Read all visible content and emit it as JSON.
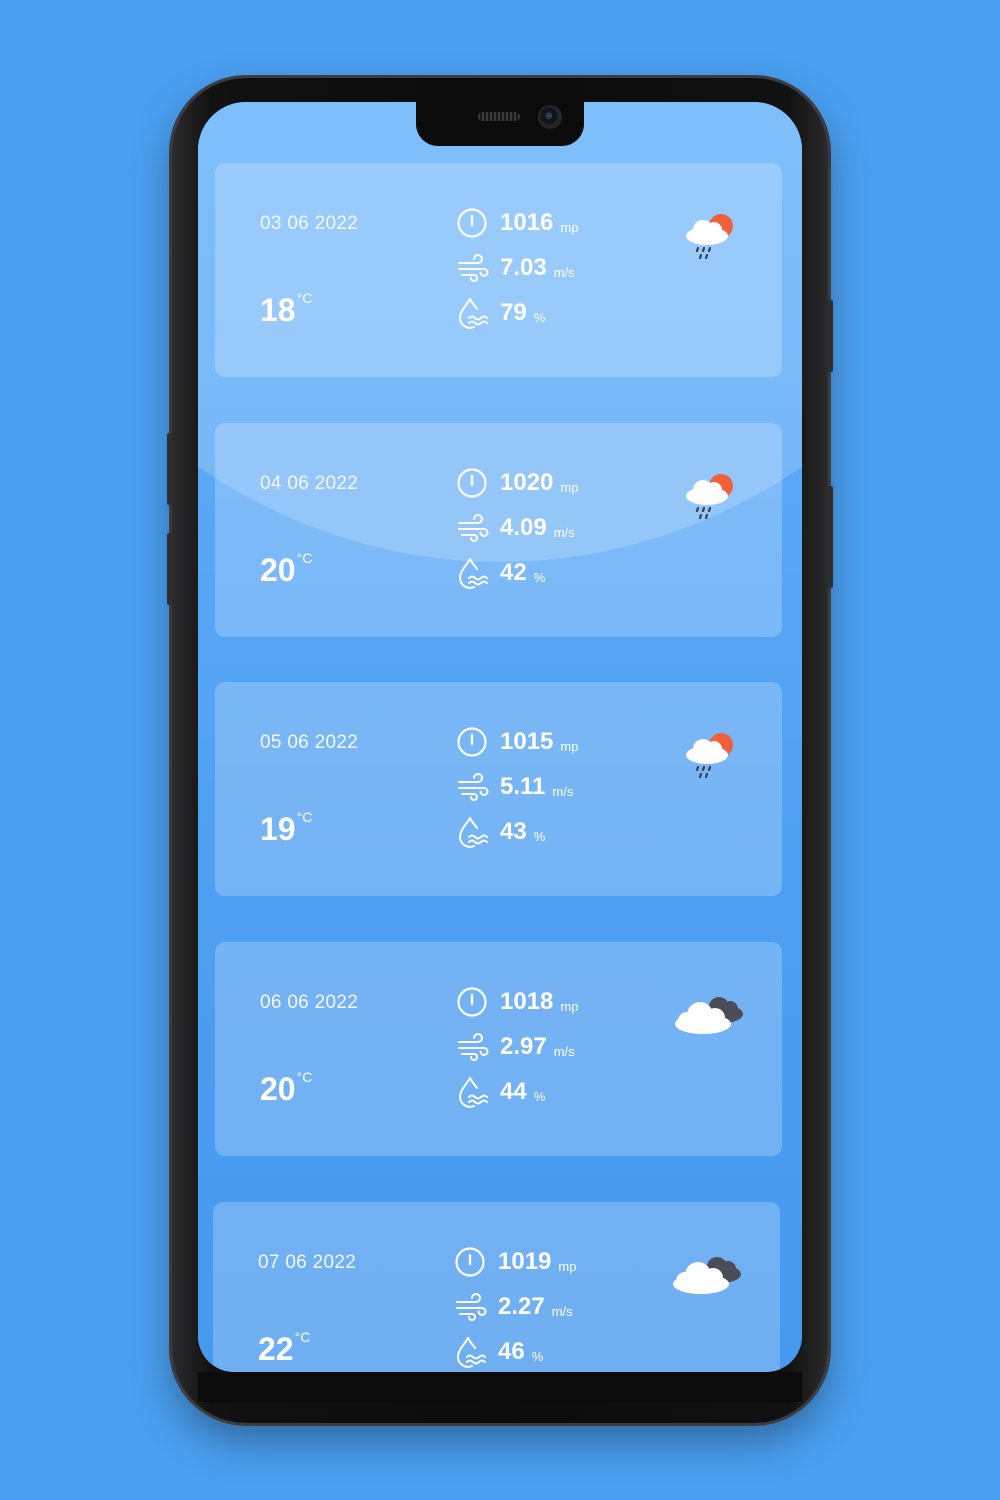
{
  "forecast": [
    {
      "date": "03 06 2022",
      "temp": "18",
      "temp_unit": "°C",
      "pressure": "1016",
      "pressure_unit": "mp",
      "wind": "7.03",
      "wind_unit": "m/s",
      "humidity": "79",
      "humidity_unit": "%",
      "icon": "cloud-sun-rain-icon"
    },
    {
      "date": "04 06 2022",
      "temp": "20",
      "temp_unit": "°C",
      "pressure": "1020",
      "pressure_unit": "mp",
      "wind": "4.09",
      "wind_unit": "m/s",
      "humidity": "42",
      "humidity_unit": "%",
      "icon": "cloud-sun-rain-icon"
    },
    {
      "date": "05 06 2022",
      "temp": "19",
      "temp_unit": "°C",
      "pressure": "1015",
      "pressure_unit": "mp",
      "wind": "5.11",
      "wind_unit": "m/s",
      "humidity": "43",
      "humidity_unit": "%",
      "icon": "cloud-sun-rain-icon"
    },
    {
      "date": "06 06 2022",
      "temp": "20",
      "temp_unit": "°C",
      "pressure": "1018",
      "pressure_unit": "mp",
      "wind": "2.97",
      "wind_unit": "m/s",
      "humidity": "44",
      "humidity_unit": "%",
      "icon": "broken-clouds-icon"
    },
    {
      "date": "07 06 2022",
      "temp": "22",
      "temp_unit": "°C",
      "pressure": "1019",
      "pressure_unit": "mp",
      "wind": "2.27",
      "wind_unit": "m/s",
      "humidity": "46",
      "humidity_unit": "%",
      "icon": "broken-clouds-icon"
    }
  ],
  "colors": {
    "background": "#4a9ff0",
    "screen_top": "#62b1fb",
    "card": "rgba(255,255,255,0.22)",
    "sun": "#f0603a",
    "dark_cloud": "#4a4d55"
  }
}
